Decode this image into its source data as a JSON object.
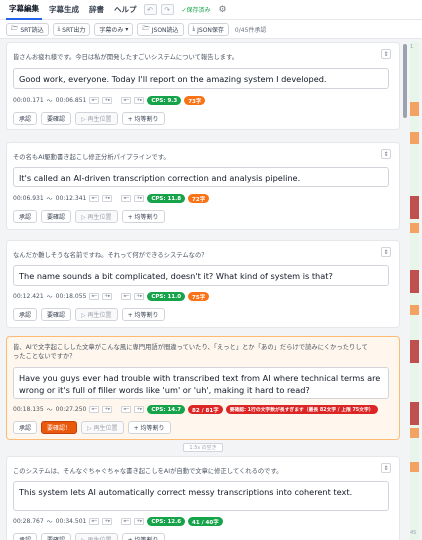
{
  "nav": {
    "tabs": [
      "字幕編集",
      "字幕生成",
      "辞書",
      "ヘルプ"
    ],
    "undo_icon": "undo-icon",
    "redo_icon": "redo-icon",
    "saved": "✓保存済み",
    "settings_icon": "gear-icon"
  },
  "toolbar": {
    "srt_import": "SRT読込",
    "srt_export": "SRT出力",
    "mode": "字幕のみ",
    "json_import": "JSON読込",
    "json_save": "JSON保存",
    "status": "0/45件承認"
  },
  "colors": {
    "accent": "#2563eb",
    "ok": "#16a34a",
    "warn": "#f97316",
    "error": "#dc2626",
    "active_bg": "#fff7ed"
  },
  "labels": {
    "approve": "承認",
    "needs_review": "要確認",
    "needs_review_active": "要確認！",
    "play_pos": "▷ 再生位置",
    "split": "+ 均等割り",
    "gap": "1.5s の空き",
    "ts_minus": "◂−",
    "ts_plus": "+▸"
  },
  "segments": [
    {
      "source": "皆さんお疲れ様です。今日は私が開発したすごいシステムについて報告します。",
      "text": "Good work, everyone. Today I'll report on the amazing system I developed.",
      "start": "00:00.171",
      "end": "00:06.851",
      "cps": "CPS: 9.3",
      "chars": "73字"
    },
    {
      "source": "その名もAI駆動書き起こし修正分析パイプラインです。",
      "text": "It's called an AI-driven transcription correction and analysis pipeline.",
      "start": "00:06.931",
      "end": "00:12.341",
      "cps": "CPS: 11.8",
      "chars": "72字"
    },
    {
      "source": "なんだか難しそうな名前ですね。それって何ができるシステムなの？",
      "text": "The name sounds a bit complicated, doesn't it? What kind of system is that?",
      "start": "00:12.421",
      "end": "00:18.055",
      "cps": "CPS: 11.0",
      "chars": "75字"
    },
    {
      "source": "皆、AIで文字起こしした文章がこんな風に専門用語が間違っていたり、「えっと」とか「あの」だらけで読みにくかったりしてったことないですか？",
      "text": "Have you guys ever had trouble with transcribed text from AI where technical terms are wrong or it's full of filler words like 'um' or 'uh', making it hard to read?",
      "start": "00:18.135",
      "end": "00:27.250",
      "cps": "CPS: 14.7",
      "chars": "82 / 81字",
      "error": "要確認: 1行の文字数が長すぎます（最長 82文字 / 上限 75文字）"
    },
    {
      "source": "このシステムは、そんなぐちゃぐちゃな書き起こしをAIが自動で文章に修正してくれるのです。",
      "text": "This system lets AI automatically correct messy transcriptions into coherent text.",
      "start": "00:28.767",
      "end": "00:34.501",
      "cps": "CPS: 12.6",
      "chars": "41 / 40字"
    }
  ],
  "minimap": {
    "top_label": "1",
    "bottom_label": "45"
  }
}
